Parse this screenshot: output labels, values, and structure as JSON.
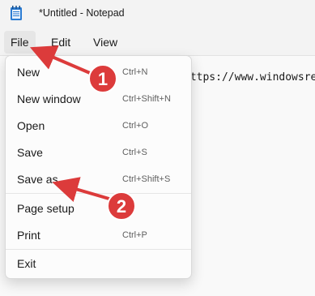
{
  "window": {
    "title": "*Untitled - Notepad",
    "icon": "notepad-icon"
  },
  "menubar": {
    "items": [
      "File",
      "Edit",
      "View"
    ]
  },
  "editor": {
    "text": "https://www.windowsreport.com"
  },
  "file_menu": {
    "items": [
      {
        "label": "New",
        "shortcut": "Ctrl+N"
      },
      {
        "label": "New window",
        "shortcut": "Ctrl+Shift+N"
      },
      {
        "label": "Open",
        "shortcut": "Ctrl+O"
      },
      {
        "label": "Save",
        "shortcut": "Ctrl+S"
      },
      {
        "label": "Save as",
        "shortcut": "Ctrl+Shift+S"
      },
      {
        "label": "Page setup",
        "shortcut": ""
      },
      {
        "label": "Print",
        "shortcut": "Ctrl+P"
      },
      {
        "label": "Exit",
        "shortcut": ""
      }
    ]
  },
  "annotations": [
    {
      "number": "1"
    },
    {
      "number": "2"
    }
  ],
  "colors": {
    "annotation_red": "#dc3b3b"
  }
}
